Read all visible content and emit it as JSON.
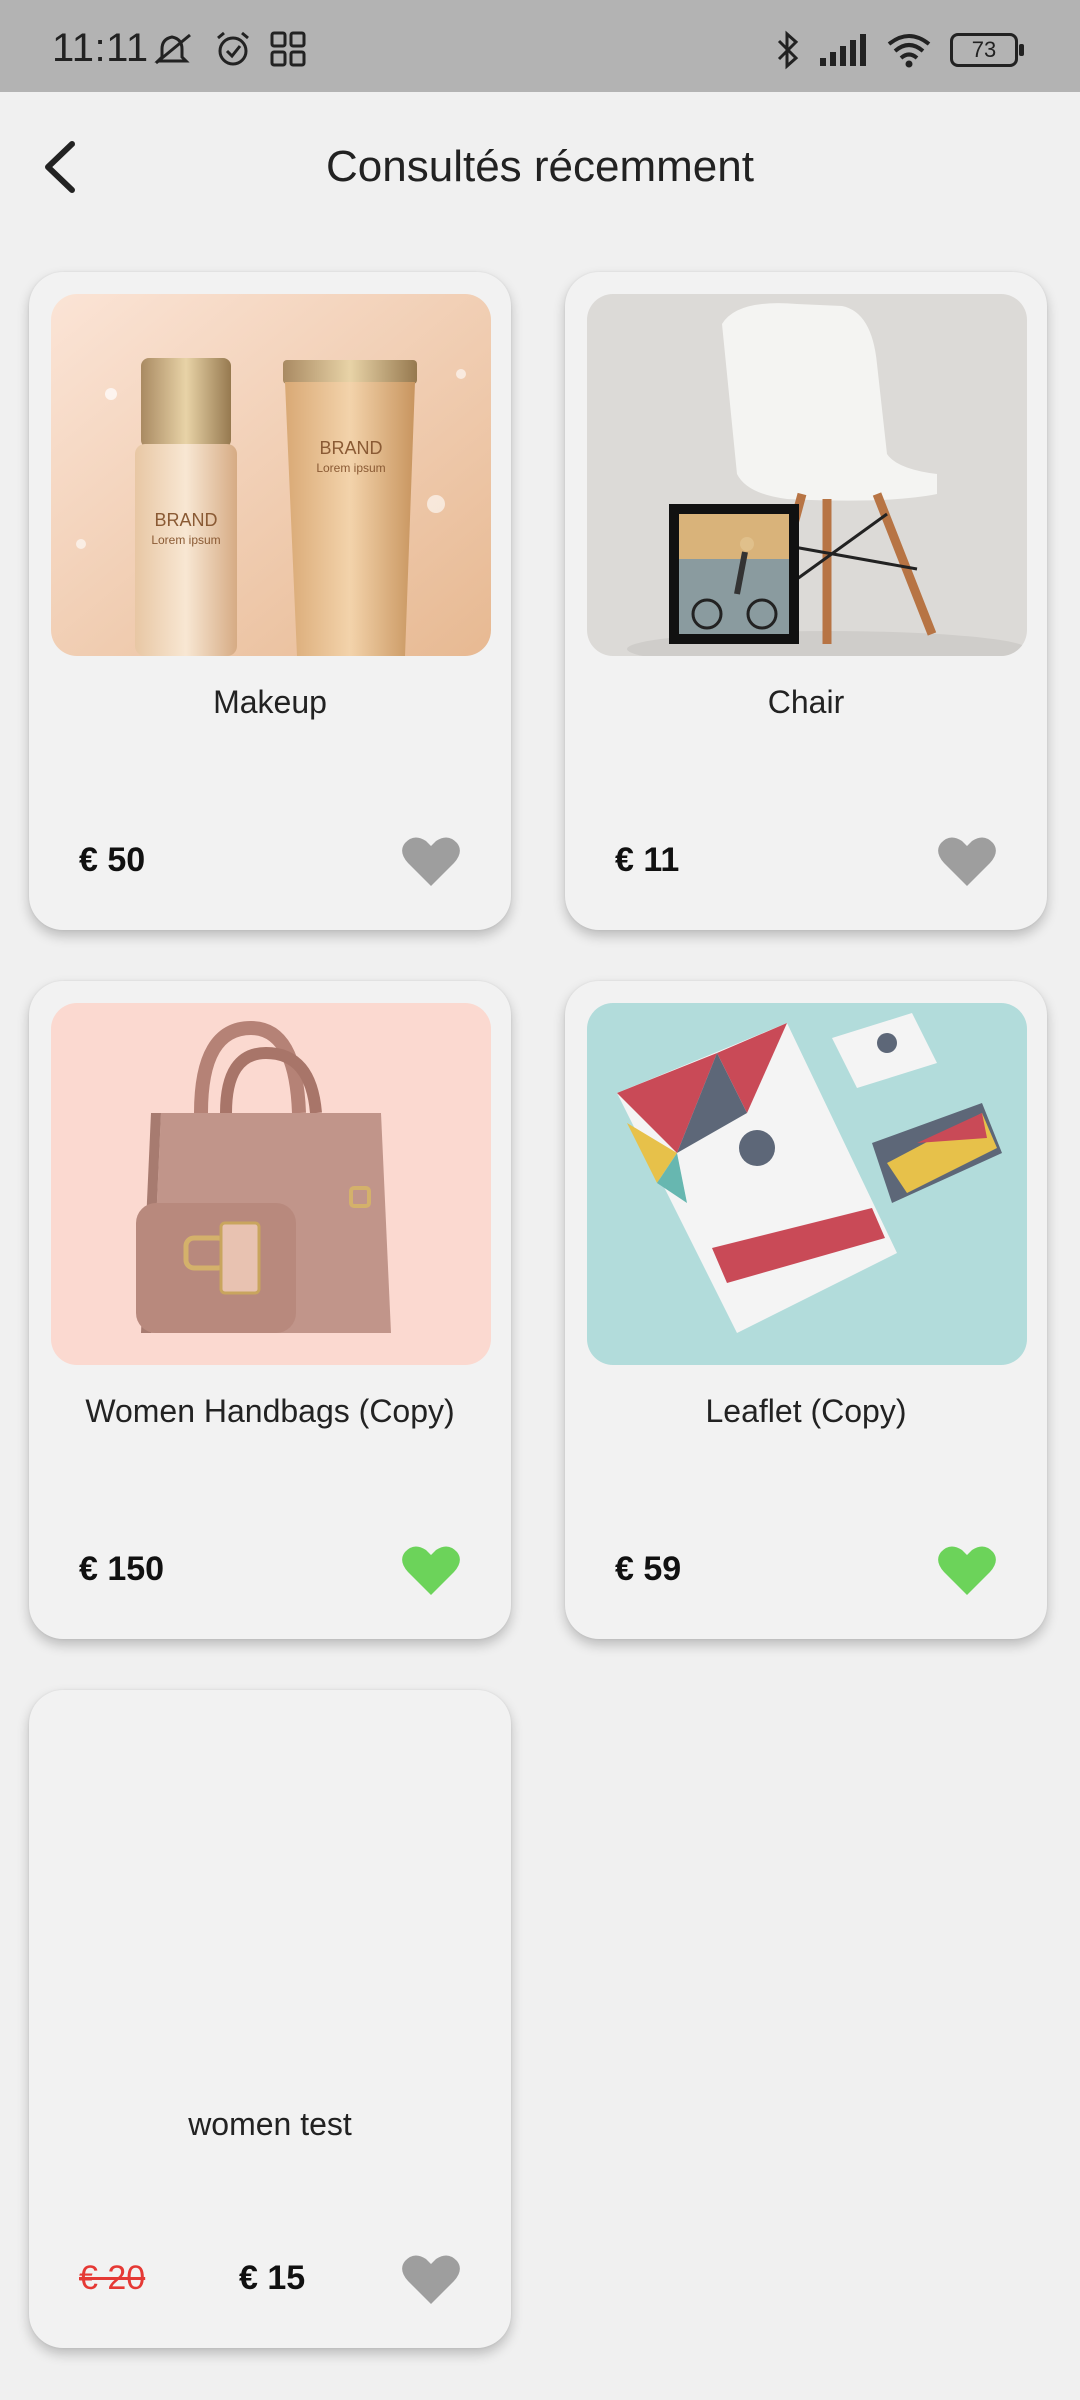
{
  "status": {
    "time": "11:11",
    "battery": "73"
  },
  "header": {
    "title": "Consultés récemment"
  },
  "colors": {
    "heart_inactive": "#9e9e9e",
    "heart_active": "#6cd35a",
    "old_price": "#e53935"
  },
  "products": [
    {
      "name": "Makeup",
      "price": "€ 50",
      "favorite": false,
      "image": "cosmetics-image"
    },
    {
      "name": "Chair",
      "price": "€ 11",
      "favorite": false,
      "image": "chair-image"
    },
    {
      "name": "Women Handbags (Copy)",
      "price": "€ 150",
      "favorite": true,
      "image": "handbag-image"
    },
    {
      "name": "Leaflet (Copy)",
      "price": "€ 59",
      "favorite": true,
      "image": "brochure-image"
    },
    {
      "name": "women test",
      "old_price": "€ 20",
      "price": "€ 15",
      "favorite": false
    }
  ]
}
